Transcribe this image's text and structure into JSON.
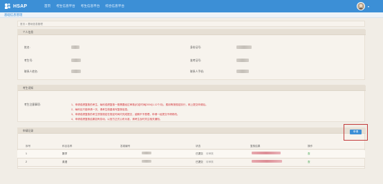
{
  "header": {
    "logo_text": "HSAP",
    "nav": [
      "首页",
      "考生信息平台",
      "考生信息平台",
      "综合信息平台"
    ],
    "brand_color": "#3c8fd6"
  },
  "subbar": {
    "title": "基础信息管理"
  },
  "breadcrumb": "首页 > 基础信息管理",
  "personal": {
    "section_title": "个人信息",
    "fields": [
      {
        "label": "姓名:",
        "value": ""
      },
      {
        "label": "身份证号:",
        "value": ""
      },
      {
        "label": "考生号:",
        "value": ""
      },
      {
        "label": "准考证号:",
        "value": ""
      },
      {
        "label": "联系人姓名:",
        "value": ""
      },
      {
        "label": "联系人手机:",
        "value": ""
      }
    ]
  },
  "notice": {
    "section_title": "考生须知",
    "label": "考生注意事项:",
    "items": [
      "1、申请成绩复核的考生，每科成绩复核一般需要经过审核(约定时间[2004]1-12个月)，费用等按规定执行，网上提交申请后。",
      "2、每科目只能申请一次，请考生慎重填写复核信息。",
      "3、申请成绩复核的考生须按规定在规定时间内完成提交，逾期不予受理，申请一经提交不得修改。",
      "4、申请成绩复核结果如有变动，以官方正式公布为准，请考生及时关注相关通知。"
    ]
  },
  "records": {
    "section_title": "申请记录",
    "apply_button": "申请",
    "columns": [
      "序号",
      "科目名称",
      "答卷编号",
      "状态",
      "复核结果",
      "操作"
    ],
    "rows": [
      {
        "no": "1",
        "subject": "数学",
        "status": "已提交",
        "sub_status": "待审核",
        "action": "查"
      },
      {
        "no": "2",
        "subject": "英语",
        "status": "已提交",
        "sub_status": "待审核",
        "action": "查"
      }
    ]
  }
}
